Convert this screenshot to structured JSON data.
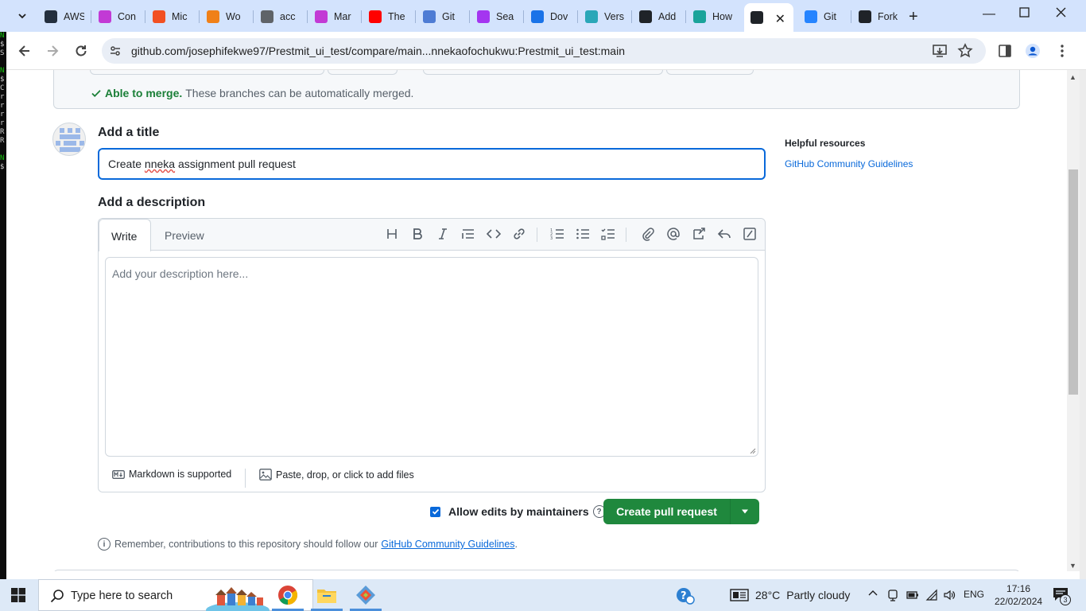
{
  "browser": {
    "tabs": [
      {
        "label": "AWS",
        "icon": "aws-icon",
        "color": "#232f3e"
      },
      {
        "label": "Con",
        "icon": "cube-icon",
        "color": "#c23ad5"
      },
      {
        "label": "Mic",
        "icon": "microsoft-icon",
        "color": "#f25022"
      },
      {
        "label": "Wo",
        "icon": "box-icon",
        "color": "#f08018"
      },
      {
        "label": "acc",
        "icon": "globe-icon",
        "color": "#5f6368"
      },
      {
        "label": "Mar",
        "icon": "cube-icon",
        "color": "#c23ad5"
      },
      {
        "label": "The",
        "icon": "youtube-icon",
        "color": "#ff0000"
      },
      {
        "label": "Git",
        "icon": "git-fork-icon",
        "color": "#4e7cd4"
      },
      {
        "label": "Sea",
        "icon": "udemy-icon",
        "color": "#a435f0"
      },
      {
        "label": "Dov",
        "icon": "download-icon",
        "color": "#1a73e8"
      },
      {
        "label": "Vers",
        "icon": "vercel-icon",
        "color": "#2aa7b8"
      },
      {
        "label": "Add",
        "icon": "github-icon",
        "color": "#1f2328"
      },
      {
        "label": "How",
        "icon": "eye-icon",
        "color": "#1aa39a"
      },
      {
        "label": "",
        "icon": "github-icon",
        "color": "#1f2328",
        "active": true
      },
      {
        "label": "Git",
        "icon": "atlassian-icon",
        "color": "#2684ff"
      },
      {
        "label": "Fork",
        "icon": "github-icon",
        "color": "#1f2328"
      }
    ],
    "url": "github.com/josephifekwe97/Prestmit_ui_test/compare/main...nnekaofochukwu:Prestmit_ui_test:main"
  },
  "terminal_strip": [
    "N",
    "$",
    "S",
    "",
    "N",
    "$",
    "C",
    "r",
    "r",
    "r",
    "r",
    "R",
    "R",
    "",
    "N",
    "$"
  ],
  "merge": {
    "status": "Able to merge.",
    "detail": "These branches can be automatically merged."
  },
  "form": {
    "title_heading": "Add a title",
    "title_value_prefix": "Create ",
    "title_value_misspelled": "nneka",
    "title_value_suffix": " assignment pull request",
    "description_heading": "Add a description",
    "tab_write": "Write",
    "tab_preview": "Preview",
    "description_placeholder": "Add your description here...",
    "markdown_note": "Markdown is supported",
    "attach_note": "Paste, drop, or click to add files",
    "allow_edits_label": "Allow edits by maintainers",
    "allow_edits_checked": true,
    "submit_label": "Create pull request",
    "remember_text": "Remember, contributions to this repository should follow our",
    "remember_link": "GitHub Community Guidelines",
    "remember_end": "."
  },
  "sidebar": {
    "heading": "Helpful resources",
    "link": "GitHub Community Guidelines"
  },
  "taskbar": {
    "search_placeholder": "Type here to search",
    "temperature": "28°C",
    "weather": "Partly cloudy",
    "language": "ENG",
    "time": "17:16",
    "date": "22/02/2024",
    "notifications": "3"
  }
}
